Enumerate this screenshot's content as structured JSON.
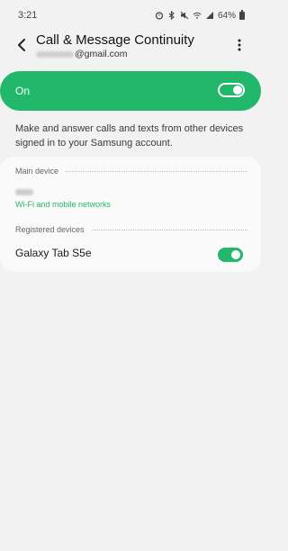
{
  "status_bar": {
    "time": "3:21",
    "battery_text": "64%",
    "icons": [
      "alarm-icon",
      "bluetooth-icon",
      "mute-icon",
      "wifi-icon",
      "signal-icon",
      "battery-icon"
    ]
  },
  "header": {
    "title": "Call & Message Continuity",
    "email_suffix": "@gmail.com"
  },
  "master_toggle": {
    "label": "On",
    "state": true
  },
  "description": "Make and answer calls and texts from other devices signed in to your Samsung account.",
  "main_device": {
    "section_label": "Main device",
    "connection": "Wi-Fi and mobile networks"
  },
  "registered_devices": {
    "section_label": "Registered devices",
    "items": [
      {
        "name": "Galaxy Tab S5e",
        "enabled": true
      }
    ]
  },
  "colors": {
    "accent": "#21b86c",
    "background": "#f2f2f2",
    "card": "#fafafa"
  }
}
